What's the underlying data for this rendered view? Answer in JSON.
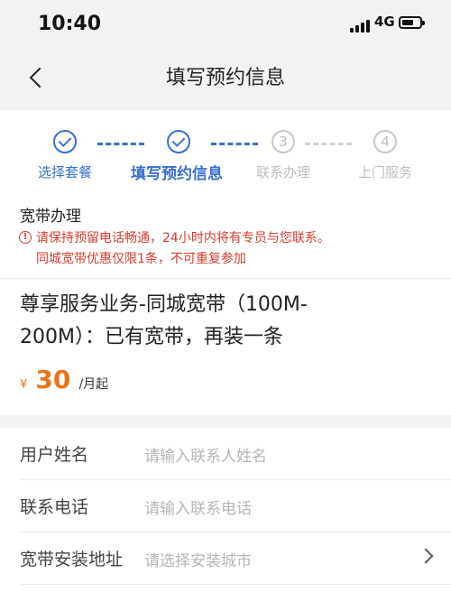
{
  "status_bar": {
    "time": "10:40",
    "network": "4G"
  },
  "nav": {
    "title": "填写预约信息"
  },
  "steps": [
    {
      "label": "选择套餐",
      "state": "done"
    },
    {
      "label": "填写预约信息",
      "state": "active"
    },
    {
      "label": "联系办理",
      "state": "pending",
      "number": "3"
    },
    {
      "label": "上门服务",
      "state": "pending",
      "number": "4"
    }
  ],
  "section": {
    "title": "宽带办理"
  },
  "notice": {
    "icon": "!",
    "line1": "请保持预留电话畅通，24小时内将有专员与您联系。",
    "line2": "同城宽带优惠仅限1条，不可重复参加"
  },
  "product": {
    "name_line1": "尊享服务业务-同城宽带（100M-",
    "name_line2": "200M）：已有宽带，再装一条",
    "currency": "¥",
    "price": "30",
    "unit": "/月起"
  },
  "form": {
    "name": {
      "label": "用户姓名",
      "placeholder": "请输入联系人姓名"
    },
    "phone": {
      "label": "联系电话",
      "placeholder": "请输入联系电话"
    },
    "address": {
      "label": "宽带安装地址",
      "placeholder": "请选择安装城市"
    }
  },
  "colors": {
    "accent": "#3a6fcd",
    "warning": "#d23c2d",
    "price": "#e8741a"
  }
}
